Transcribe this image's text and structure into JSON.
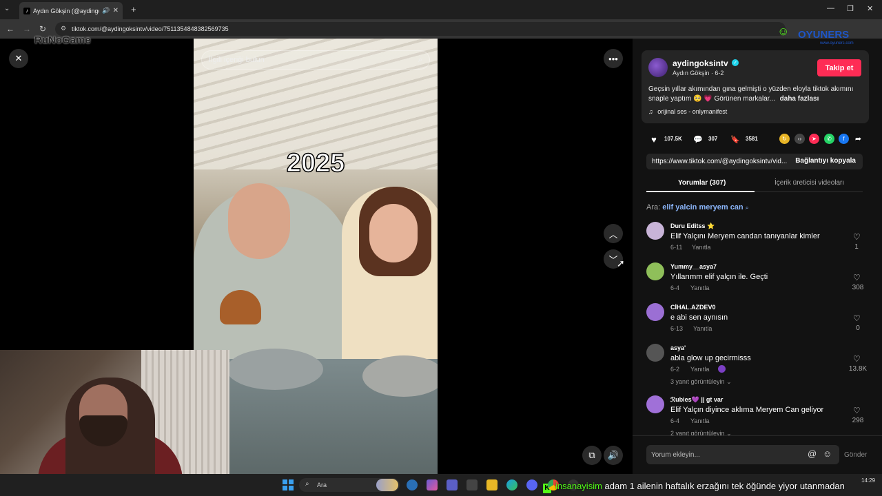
{
  "browser": {
    "tab_title": "Aydın Gökşin (@aydingoks",
    "url": "tiktok.com/@aydingoksintv/video/7511354848382569735"
  },
  "overlay": {
    "channel_logo": "RuNoGame",
    "brand_logo": "OYUNERS",
    "brand_sub": "www.oyuners.com"
  },
  "video": {
    "search_placeholder": "İlgili içeriği bulun",
    "overlay_text": "2025"
  },
  "author": {
    "username": "aydingoksintv",
    "display_line": "Aydın Gökşin · 6-2",
    "follow_label": "Takip et",
    "caption": "Geçsin yıllar akımından gına gelmişti o yüzden eloyla tiktok akımını snaple yaptım 🥺 💗 Görünen markalar...",
    "more_label": "daha fazlası",
    "sound": "orijinal ses - onlymanifest"
  },
  "stats": {
    "likes": "107.5K",
    "comments": "307",
    "saves": "3581"
  },
  "link": {
    "url": "https://www.tiktok.com/@aydingoksintv/vid...",
    "copy_label": "Bağlantıyı kopyala"
  },
  "tabs": {
    "comments": "Yorumlar (307)",
    "creator_videos": "İçerik üreticisi videoları"
  },
  "search_suggestion": {
    "prefix": "Ara:",
    "query": "elif yalcin meryem can"
  },
  "comments": [
    {
      "user": "Duru Editss ⭐",
      "text": "Elif Yalçını Meryem candan tanıyanlar kimler",
      "date": "6-11",
      "reply": "Yanıtla",
      "likes": "1",
      "more": ""
    },
    {
      "user": "Yummy__asya7",
      "text": "Yıllarımm elif yalçın ile. Geçti",
      "date": "6-4",
      "reply": "Yanıtla",
      "likes": "308",
      "more": ""
    },
    {
      "user": "CİHAL.AZDEV0",
      "text": "e abi sen aynısın",
      "date": "6-13",
      "reply": "Yanıtla",
      "likes": "0",
      "more": ""
    },
    {
      "user": "asya'",
      "text": "abla glow up gecirmisss",
      "date": "6-2",
      "reply": "Yanıtla",
      "likes": "13.8K",
      "more": "3 yanıt görüntüleyin"
    },
    {
      "user": "ℛubies💜 || gt var",
      "text": "Elif Yalçın diyince aklıma Meryem Can geliyor",
      "date": "6-4",
      "reply": "Yanıtla",
      "likes": "298",
      "more": "2 yanıt görüntüleyin"
    }
  ],
  "comment_input": {
    "placeholder": "Yorum ekleyin...",
    "send": "Gönder"
  },
  "taskbar": {
    "search_label": "Ara",
    "ticker_user": "insanayisim",
    "ticker_text": "adam 1 ailenin haftalık erzağını tek öğünde yiyor utanmadan",
    "time": "14:29"
  },
  "colors": {
    "follow_red": "#fe2c55",
    "verified_blue": "#20d5ec",
    "kick_green": "#53fc18"
  }
}
